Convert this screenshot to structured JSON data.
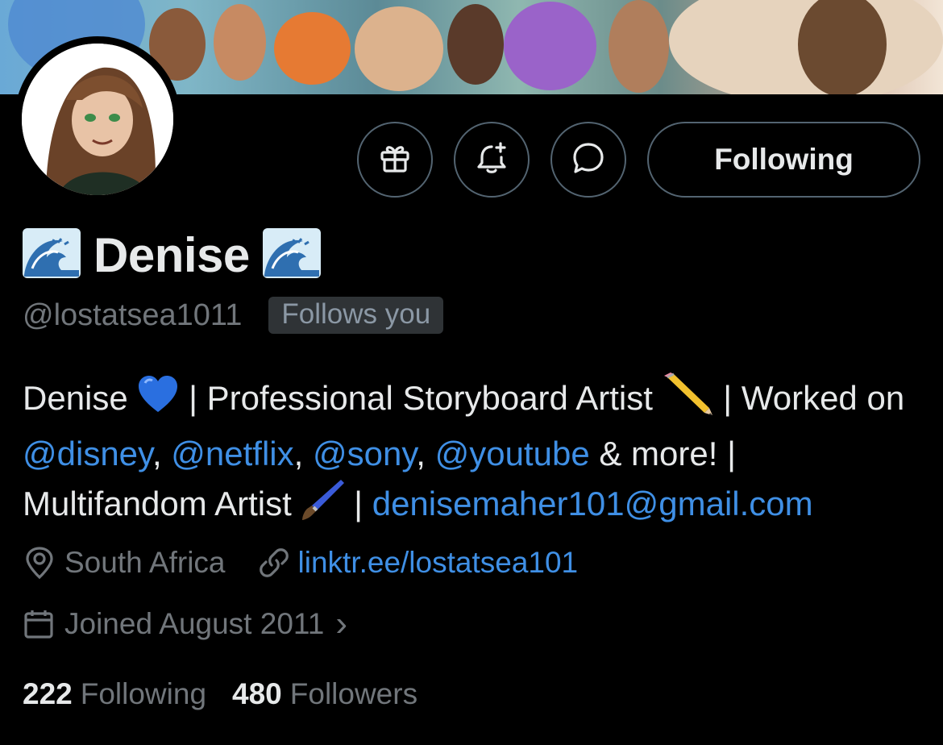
{
  "profile": {
    "display_name": "Denise",
    "handle": "@lostatsea1011",
    "follows_you": "Follows you"
  },
  "actions": {
    "gift_icon": "gift-icon",
    "notify_icon": "bell-plus-icon",
    "message_icon": "message-bubble-icon",
    "follow_label": "Following"
  },
  "bio": {
    "part1": "Denise ",
    "part2": " | Professional Storyboard Artist ",
    "part3": " | Worked on ",
    "mention1": "@disney",
    "sep1": ", ",
    "mention2": "@netflix",
    "sep2": ", ",
    "mention3": "@sony",
    "sep3": ", ",
    "mention4": "@youtube",
    "part4": " & more! | Multifandom Artist ",
    "part5": " | ",
    "email": "denisemaher101@gmail.com"
  },
  "meta": {
    "location": "South Africa",
    "website": "linktr.ee/lostatsea101",
    "joined": "Joined August 2011",
    "joined_chevron": "›"
  },
  "stats": {
    "following_count": "222",
    "following_label": "Following",
    "followers_count": "480",
    "followers_label": "Followers"
  },
  "colors": {
    "background": "#000000",
    "link": "#3f8fe5",
    "muted": "#71767b",
    "border": "#536471"
  }
}
